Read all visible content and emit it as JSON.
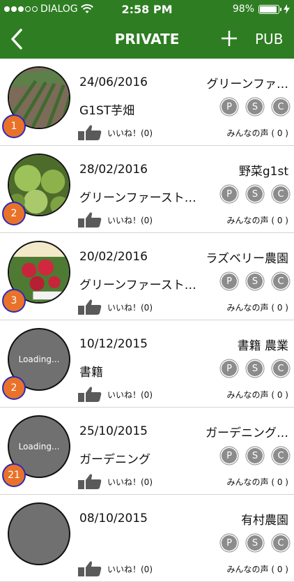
{
  "status": {
    "carrier": "DIALOG",
    "time": "2:58 PM",
    "battery": "98%",
    "battery_fraction": 0.98
  },
  "nav": {
    "title": "PRIVATE",
    "pub_label": "PUB"
  },
  "items": [
    {
      "date": "24/06/2016",
      "author": "グリーンファ…",
      "name": "G1ST芋畑",
      "badge": "1",
      "image": "field-photo",
      "loading": ""
    },
    {
      "date": "28/02/2016",
      "author": "野菜g1st",
      "name": "グリーンファースト…",
      "badge": "2",
      "image": "cabbage-photo",
      "loading": ""
    },
    {
      "date": "20/02/2016",
      "author": "ラズベリー農園",
      "name": "グリーンファースト…",
      "badge": "3",
      "image": "raspberry-photo",
      "loading": ""
    },
    {
      "date": "10/12/2015",
      "author": "書籍 農業",
      "name": "書籍",
      "badge": "2",
      "image": "",
      "loading": "Loading..."
    },
    {
      "date": "25/10/2015",
      "author": "ガーデニング…",
      "name": "ガーデニング",
      "badge": "21",
      "image": "",
      "loading": "Loading..."
    },
    {
      "date": "08/10/2015",
      "author": "有村農園",
      "name": "",
      "badge": "",
      "image": "",
      "loading": ""
    }
  ],
  "labels": {
    "p": "P",
    "s": "S",
    "c": "C",
    "like": "いいね！(0)",
    "voice": "みんなの声 ( 0 )"
  }
}
